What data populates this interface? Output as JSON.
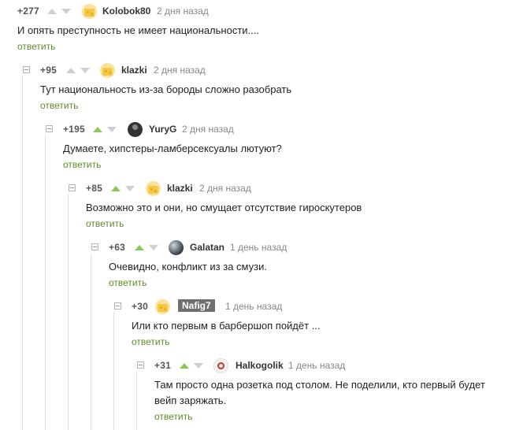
{
  "reply_label": "ответить",
  "colors": {
    "upvote_active": "#8ac858",
    "vote_inactive": "#cfcfcf",
    "reply_link": "#5f8b2b"
  },
  "comments": [
    {
      "rating": "+277",
      "user": "Kolobok80",
      "date": "2 дня назад",
      "avatar": "cheese-icon",
      "upvoted": false,
      "text": "И опять преступность не имеет национальности...."
    },
    {
      "rating": "+95",
      "user": "klazki",
      "date": "2 дня назад",
      "avatar": "cheese-icon",
      "upvoted": false,
      "text": "Тут национальность из-за бороды сложно разобрать"
    },
    {
      "rating": "+195",
      "user": "YuryG",
      "date": "2 дня назад",
      "avatar": "dark-avatar-icon",
      "upvoted": true,
      "text": "Думаете, хипстеры-ламберсексуалы лютуют?"
    },
    {
      "rating": "+85",
      "user": "klazki",
      "date": "2 дня назад",
      "avatar": "cheese-icon",
      "upvoted": true,
      "text": "Возможно это и они, но смущает отсутствие гироскутеров"
    },
    {
      "rating": "+63",
      "user": "Galatan",
      "date": "1 день назад",
      "avatar": "sphere-icon",
      "upvoted": true,
      "text": "Очевидно, конфликт из за смузи."
    },
    {
      "rating": "+30",
      "user": "Nafig7",
      "date": "1 день назад",
      "avatar": "cheese-icon",
      "upvoted": false,
      "text": "Или кто первым в барбершоп пойдёт ..."
    },
    {
      "rating": "+31",
      "user": "Halkogolik",
      "date": "1 день назад",
      "avatar": "clown-icon",
      "upvoted": true,
      "text": "Там просто одна розетка под столом. Не поделили, кто первый будет вейп заряжать."
    }
  ]
}
